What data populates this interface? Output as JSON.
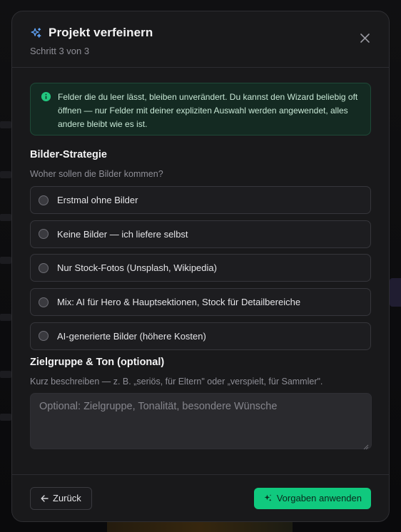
{
  "dialog": {
    "title": "Projekt verfeinern",
    "step": "Schritt 3 von 3",
    "close_icon": "close-icon",
    "title_icon": "sparkle-icon"
  },
  "info": {
    "icon": "info-icon",
    "text": "Felder die du leer lässt, bleiben unverändert. Du kannst den Wizard beliebig oft öffnen — nur Felder mit deiner expliziten Auswahl werden angewendet, alles andere bleibt wie es ist."
  },
  "images_section": {
    "title": "Bilder-Strategie",
    "question": "Woher sollen die Bilder kommen?",
    "options": [
      {
        "label": "Erstmal ohne Bilder",
        "selected": false
      },
      {
        "label": "Keine Bilder — ich liefere selbst",
        "selected": false
      },
      {
        "label": "Nur Stock-Fotos (Unsplash, Wikipedia)",
        "selected": false
      },
      {
        "label": "Mix: AI für Hero & Hauptsektionen, Stock für Detailbereiche",
        "selected": false
      },
      {
        "label": "AI-generierte Bilder (höhere Kosten)",
        "selected": false
      }
    ]
  },
  "audience_section": {
    "title": "Zielgruppe & Ton (optional)",
    "hint": "Kurz beschreiben — z. B. „seriös, für Eltern\" oder „verspielt, für Sammler\".",
    "placeholder": "Optional: Zielgruppe, Tonalität, besondere Wünsche",
    "value": ""
  },
  "footer": {
    "back_label": "Zurück",
    "back_icon": "arrow-left-icon",
    "apply_label": "Vorgaben anwenden",
    "apply_icon": "sparkle-icon"
  },
  "colors": {
    "accent": "#10c97e",
    "info_bg": "#142a22",
    "sparkle": "#60a5fa"
  }
}
